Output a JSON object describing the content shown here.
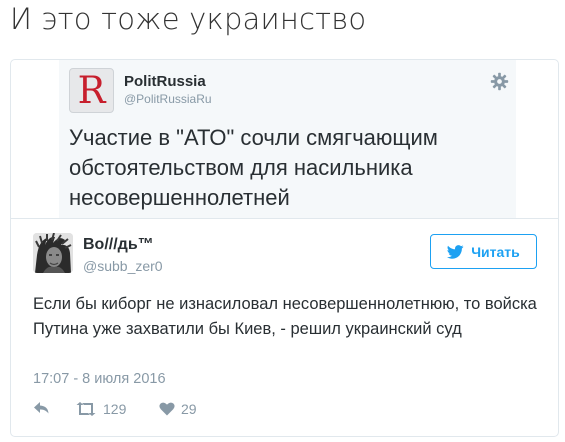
{
  "header": {
    "title": "И это тоже украинство"
  },
  "quoted_tweet": {
    "logo_letter": "R",
    "author_name": "PolitRussia",
    "author_handle": "@PolitRussiaRu",
    "text": "Участие в \"АТО\" сочли смягчающим обстоятельством для насильника несовершеннолетней",
    "icons": {
      "settings": "gear-icon"
    }
  },
  "tweet": {
    "author_name": "Во///дь™",
    "author_handle": "@subb_zer0",
    "follow_label": "Читать",
    "text": "Если бы киборг не изнасиловал несовершеннолетнюю, то войска Путина уже захватили бы Киев, - решил украинский суд",
    "timestamp": "17:07 - 8 июля 2016",
    "retweet_count": "129",
    "like_count": "29"
  },
  "colors": {
    "accent": "#1da1f2",
    "muted": "#8899a6",
    "text": "#292f33",
    "logo_red": "#c71f2d"
  }
}
